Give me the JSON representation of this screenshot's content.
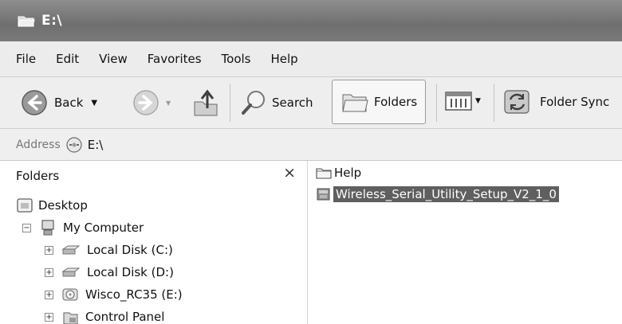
{
  "window": {
    "title": "E:\\",
    "title_icon": "folder-open-icon"
  },
  "menu": [
    "File",
    "Edit",
    "View",
    "Favorites",
    "Tools",
    "Help"
  ],
  "toolbar": {
    "back": "Back",
    "search": "Search",
    "folders": "Folders",
    "folder_sync": "Folder Sync"
  },
  "address": {
    "label": "Address",
    "value": "E:\\"
  },
  "folders_pane": {
    "title": "Folders",
    "close_glyph": "×",
    "tree": [
      {
        "label": "Desktop",
        "icon": "desktop-icon"
      },
      {
        "label": "My Computer",
        "icon": "computer-icon",
        "expander": "−"
      },
      {
        "label": "Local Disk (C:)",
        "icon": "drive-icon",
        "expander": "+"
      },
      {
        "label": "Local Disk (D:)",
        "icon": "drive-icon",
        "expander": "+"
      },
      {
        "label": "Wisco_RC35 (E:)",
        "icon": "cd-drive-icon",
        "expander": "+"
      },
      {
        "label": "Control Panel",
        "icon": "control-panel-icon",
        "expander": "+"
      }
    ]
  },
  "content": {
    "items": [
      {
        "label": "Help",
        "icon": "folder-icon",
        "selected": false
      },
      {
        "label": "Wireless_Serial_Utility_Setup_V2_1_0",
        "icon": "installer-icon",
        "selected": true
      }
    ]
  }
}
